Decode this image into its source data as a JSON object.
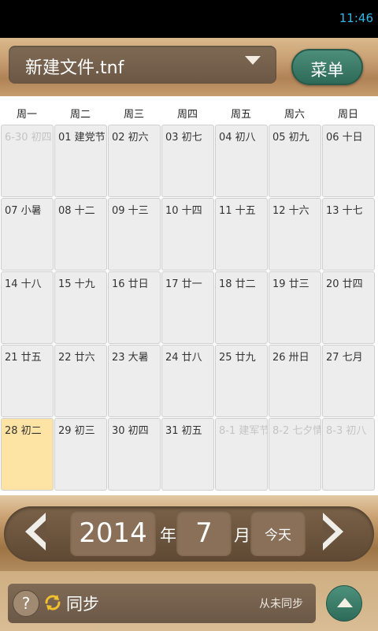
{
  "status": {
    "time": "11:46"
  },
  "header": {
    "file_name": "新建文件.tnf",
    "menu_label": "菜单"
  },
  "calendar": {
    "weekdays": [
      "周一",
      "周二",
      "周三",
      "周四",
      "周五",
      "周六",
      "周日"
    ],
    "weeks": [
      [
        {
          "label": "6-30 初四",
          "dim": true
        },
        {
          "label": "01 建党节",
          "dim": false
        },
        {
          "label": "02 初六",
          "dim": false
        },
        {
          "label": "03 初七",
          "dim": false
        },
        {
          "label": "04 初八",
          "dim": false
        },
        {
          "label": "05 初九",
          "dim": false
        },
        {
          "label": "06 十日",
          "dim": false
        }
      ],
      [
        {
          "label": "07 小暑",
          "dim": false
        },
        {
          "label": "08 十二",
          "dim": false
        },
        {
          "label": "09 十三",
          "dim": false
        },
        {
          "label": "10 十四",
          "dim": false
        },
        {
          "label": "11 十五",
          "dim": false
        },
        {
          "label": "12 十六",
          "dim": false
        },
        {
          "label": "13 十七",
          "dim": false
        }
      ],
      [
        {
          "label": "14 十八",
          "dim": false
        },
        {
          "label": "15 十九",
          "dim": false
        },
        {
          "label": "16 廿日",
          "dim": false
        },
        {
          "label": "17 廿一",
          "dim": false
        },
        {
          "label": "18 廿二",
          "dim": false
        },
        {
          "label": "19 廿三",
          "dim": false
        },
        {
          "label": "20 廿四",
          "dim": false
        }
      ],
      [
        {
          "label": "21 廿五",
          "dim": false
        },
        {
          "label": "22 廿六",
          "dim": false
        },
        {
          "label": "23 大暑",
          "dim": false
        },
        {
          "label": "24 廿八",
          "dim": false
        },
        {
          "label": "25 廿九",
          "dim": false
        },
        {
          "label": "26 卅日",
          "dim": false
        },
        {
          "label": "27 七月",
          "dim": false
        }
      ],
      [
        {
          "label": "28 初二",
          "dim": false,
          "today": true
        },
        {
          "label": "29 初三",
          "dim": false
        },
        {
          "label": "30 初四",
          "dim": false
        },
        {
          "label": "31 初五",
          "dim": false
        },
        {
          "label": "8-1 建军节",
          "dim": true
        },
        {
          "label": "8-2 七夕情",
          "dim": true
        },
        {
          "label": "8-3 初八",
          "dim": true
        }
      ]
    ]
  },
  "nav": {
    "year": "2014",
    "year_unit": "年",
    "month": "7",
    "month_unit": "月",
    "today_label": "今天"
  },
  "bottom": {
    "help_label": "?",
    "sync_label": "同步",
    "sync_status": "从未同步"
  },
  "colors": {
    "today_cell": "#fde3a4",
    "accent_green": "#2e6a58",
    "status_time": "#33b5e5"
  },
  "icons": {
    "dropdown": "chevron-down-icon",
    "prev": "chevron-left-icon",
    "next": "chevron-right-icon",
    "sync": "sync-icon",
    "up": "chevron-up-icon"
  }
}
